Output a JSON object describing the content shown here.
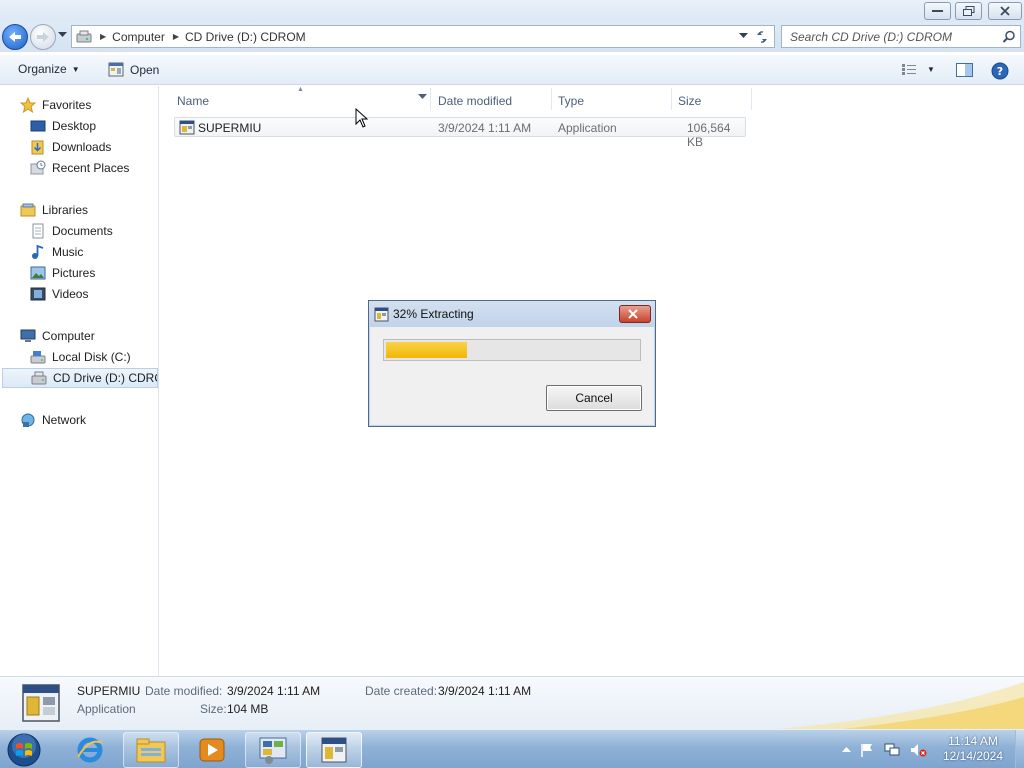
{
  "window": {
    "buttons": {
      "minimize": "minimize-icon",
      "restore": "restore-icon",
      "close": "close-icon"
    }
  },
  "navigation": {
    "breadcrumb": [
      "Computer",
      "CD Drive (D:) CDROM"
    ],
    "search_placeholder": "Search CD Drive (D:) CDROM"
  },
  "toolbar": {
    "organize_label": "Organize",
    "open_label": "Open"
  },
  "sidebar": {
    "favorites": {
      "label": "Favorites",
      "items": [
        {
          "label": "Desktop",
          "icon": "desktop-icon"
        },
        {
          "label": "Downloads",
          "icon": "downloads-icon"
        },
        {
          "label": "Recent Places",
          "icon": "recent-places-icon"
        }
      ]
    },
    "libraries": {
      "label": "Libraries",
      "items": [
        {
          "label": "Documents",
          "icon": "documents-icon"
        },
        {
          "label": "Music",
          "icon": "music-icon"
        },
        {
          "label": "Pictures",
          "icon": "pictures-icon"
        },
        {
          "label": "Videos",
          "icon": "videos-icon"
        }
      ]
    },
    "computer": {
      "label": "Computer",
      "items": [
        {
          "label": "Local Disk (C:)",
          "icon": "local-disk-icon"
        },
        {
          "label": "CD Drive (D:) CDROM",
          "icon": "cd-drive-icon",
          "selected": true
        }
      ]
    },
    "network": {
      "label": "Network"
    }
  },
  "filelist": {
    "columns": [
      "Name",
      "Date modified",
      "Type",
      "Size"
    ],
    "files": [
      {
        "name": "SUPERMIU",
        "date_modified": "3/9/2024 1:11 AM",
        "type": "Application",
        "size": "106,564 KB"
      }
    ]
  },
  "dialog": {
    "title": "32% Extracting",
    "progress": 0.32,
    "cancel_label": "Cancel",
    "progress_color": "#f2b705"
  },
  "details": {
    "name": "SUPERMIU",
    "type": "Application",
    "date_modified_label": "Date modified:",
    "date_modified": "3/9/2024 1:11 AM",
    "size_label": "Size:",
    "size": "104 MB",
    "date_created_label": "Date created:",
    "date_created": "3/9/2024 1:11 AM"
  },
  "taskbar": {
    "apps": [
      "internet-explorer-icon",
      "windows-explorer-icon",
      "media-player-icon",
      "control-panel-icon",
      "supermiu-app-icon"
    ],
    "clock": {
      "time": "11:14 AM",
      "date": "12/14/2024"
    },
    "tray": [
      "show-hidden-icons",
      "action-center-flag-icon",
      "network-icon",
      "volume-muted-icon"
    ]
  },
  "colors": {
    "accent": "#1f5fc5",
    "progress": "#f2b705",
    "taskbar": "#8fb1d6"
  }
}
